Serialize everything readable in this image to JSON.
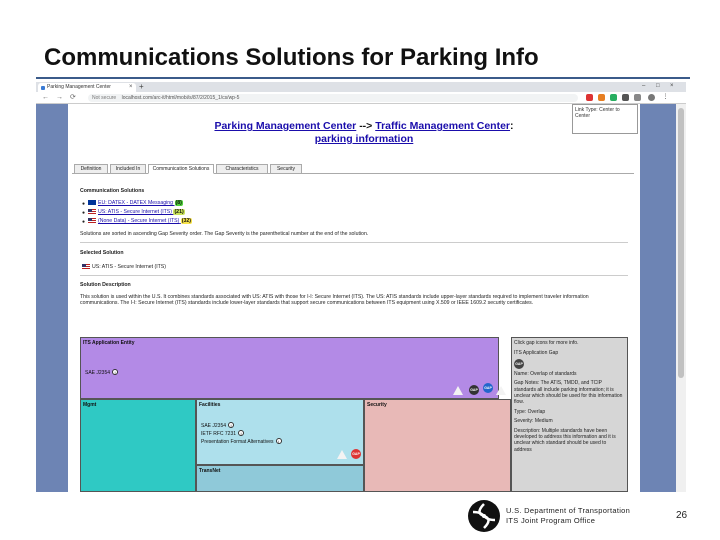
{
  "slide": {
    "title": "Communications Solutions for Parking Info",
    "page_number": "26",
    "footer_line1": "U.S. Department of Transportation",
    "footer_line2": "ITS Joint Program Office"
  },
  "browser": {
    "tab_title": "Parking Management Center",
    "tab_close": "×",
    "new_tab": "+",
    "not_secure": "Not secure",
    "url": "localhost.com/arc-it/html/mobi/s/87/2/2015_1/cs/wp-5",
    "nav_back": "←",
    "nav_forward": "→",
    "nav_reload": "⟳"
  },
  "page": {
    "header_link1": "Parking Management Center",
    "header_arrow": "-->",
    "header_link2": "Traffic Management Center",
    "header_colon": ":",
    "header_link3": "parking information",
    "side_note": "Link Type: Center to Center",
    "tabs": [
      {
        "label": "Definition"
      },
      {
        "label": "Included In"
      },
      {
        "label": "Communication Solutions"
      },
      {
        "label": "Characteristics"
      },
      {
        "label": "Security"
      }
    ],
    "comm_solutions_heading": "Communication Solutions",
    "solutions": [
      {
        "text": "EU: DATEX - DATEX Messaging",
        "severity": "(8)"
      },
      {
        "text": "US: ATIS - Secure Internet (ITS)",
        "severity": "(21)"
      },
      {
        "text": "(None Data) - Secure Internet (ITS)",
        "severity": "(32)"
      }
    ],
    "sort_note": "Solutions are sorted in ascending Gap Severity order. The Gap Severity is the parenthetical number at the end of the solution.",
    "selected_heading": "Selected Solution",
    "selected_solution": "US: ATIS - Secure Internet (ITS)",
    "description_heading": "Solution Description",
    "description": "This solution is used within the U.S. It combines standards associated with US: ATIS with those for I-I: Secure Internet (ITS). The US: ATIS standards include upper-layer standards required to implement traveler information communications. The I-I: Secure Internet (ITS) standards include lower-layer standards that support secure communications between ITS equipment using X.509 or IEEE 1609.2 security certificates.",
    "diagram": {
      "its_app_entity": "ITS Application Entity",
      "sae": "SAE J2354",
      "mgmt": "Mgmt",
      "facilities": "Facilities",
      "security": "Security",
      "fac_items": [
        "SAE J2354",
        "IETF RFC 7231",
        "Presentation Format Alternatives"
      ],
      "transnet": "TransNet",
      "gap_prompt": "Click gap icons for more info.",
      "gap_title": "ITS Application Gap",
      "gap_name": "Name: Overlap of standards",
      "gap_notes": "Gap Notes: The ATIS, TMDD, and TCIP standards all include parking information; it is unclear which should be used for this information flow.",
      "gap_type": "Type: Overlap",
      "gap_severity": "Severity: Medium",
      "gap_description": "Description: Multiple standards have been developed to address this information and it is unclear which standard should be used to address"
    }
  },
  "colors": {
    "slide_rule": "#3b5b8a",
    "frame": "#6d84b4",
    "link": "#1a0dab",
    "its_app": "#b38ae6",
    "mgmt": "#2fc9c4",
    "facilities": "#aee0ec",
    "security": "#e8b9b7",
    "gap_panel": "#d6d6d6"
  }
}
